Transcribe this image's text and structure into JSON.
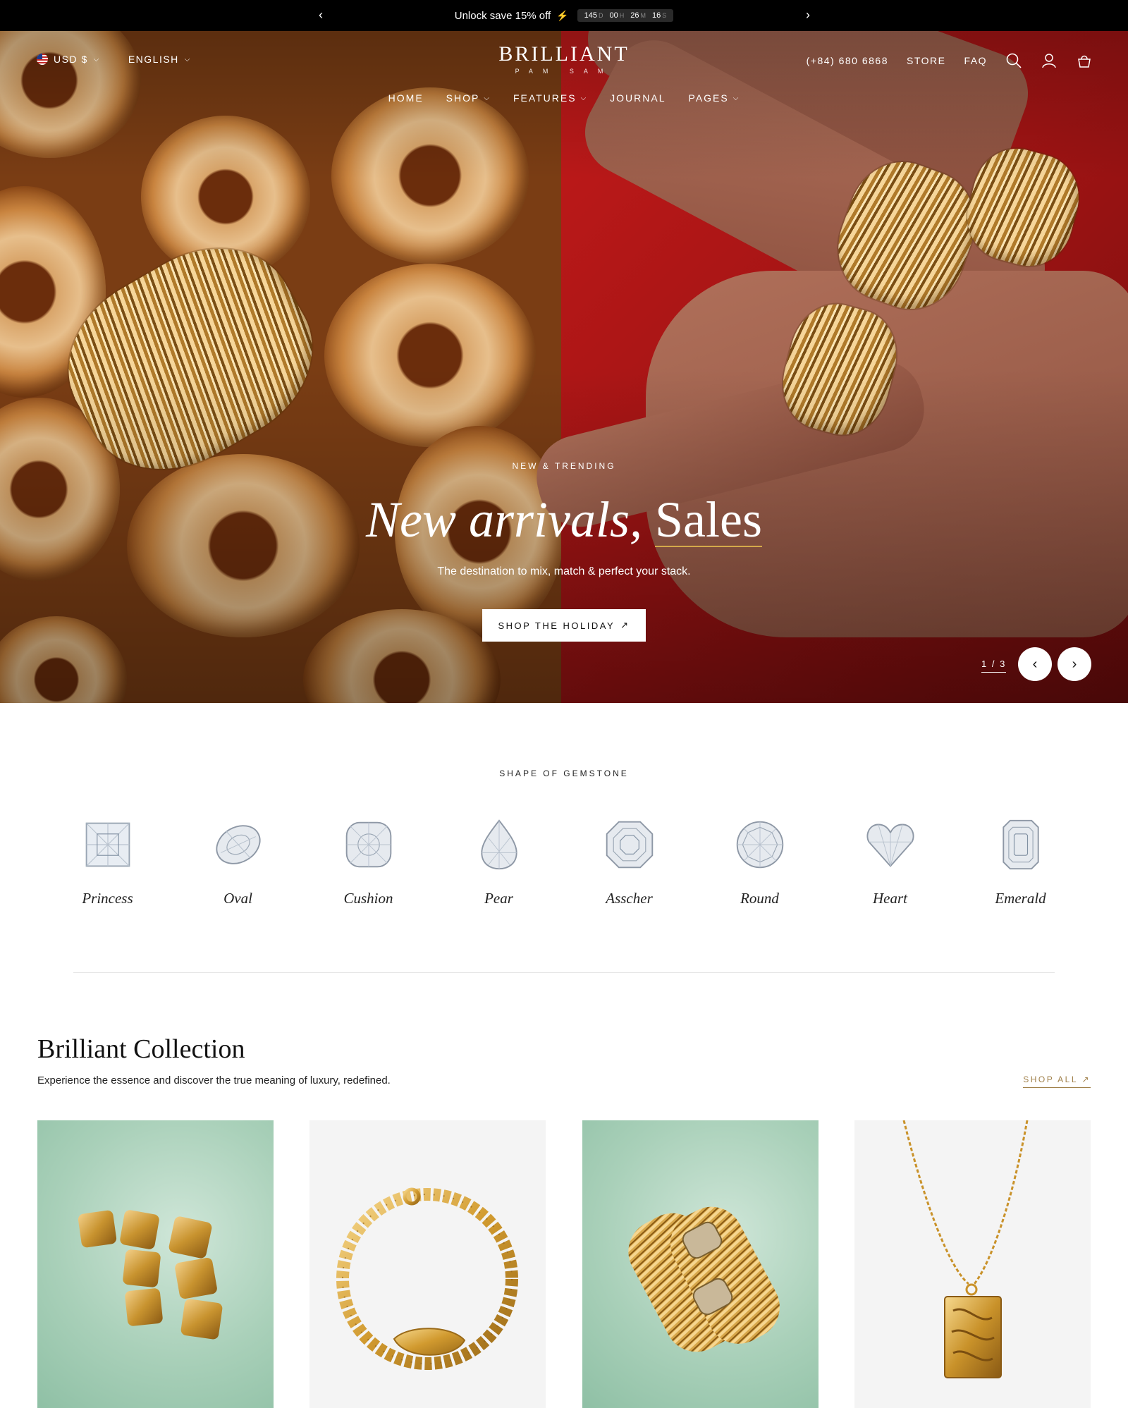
{
  "announcement": {
    "message": "Unlock save 15% off",
    "countdown": [
      {
        "value": "145",
        "unit": "D"
      },
      {
        "value": "00",
        "unit": "H"
      },
      {
        "value": "26",
        "unit": "M"
      },
      {
        "value": "16",
        "unit": "S"
      }
    ]
  },
  "header": {
    "currency": "USD $",
    "language": "ENGLISH",
    "logo_name": "BRILLIANT",
    "logo_sub": "PAM SAM",
    "phone": "(+84) 680 6868",
    "store": "STORE",
    "faq": "FAQ",
    "nav": [
      "HOME",
      "SHOP",
      "FEATURES",
      "JOURNAL",
      "PAGES"
    ]
  },
  "hero": {
    "eyebrow": "NEW & TRENDING",
    "headline_italic": "New arrivals,",
    "headline_underlined": "Sales",
    "subline": "The destination to mix, match & perfect your stack.",
    "cta": "SHOP THE HOLIDAY",
    "pager": "1 / 3"
  },
  "gemstones": {
    "title": "SHAPE OF GEMSTONE",
    "items": [
      "Princess",
      "Oval",
      "Cushion",
      "Pear",
      "Asscher",
      "Round",
      "Heart",
      "Emerald"
    ]
  },
  "collection": {
    "title": "Brilliant Collection",
    "subtitle": "Experience the essence and discover the true meaning of luxury, redefined.",
    "shop_all": "SHOP ALL"
  },
  "colors": {
    "announcement_bg": "#000000",
    "accent_gold": "#a0804a",
    "hero_red": "#c21a1a"
  }
}
